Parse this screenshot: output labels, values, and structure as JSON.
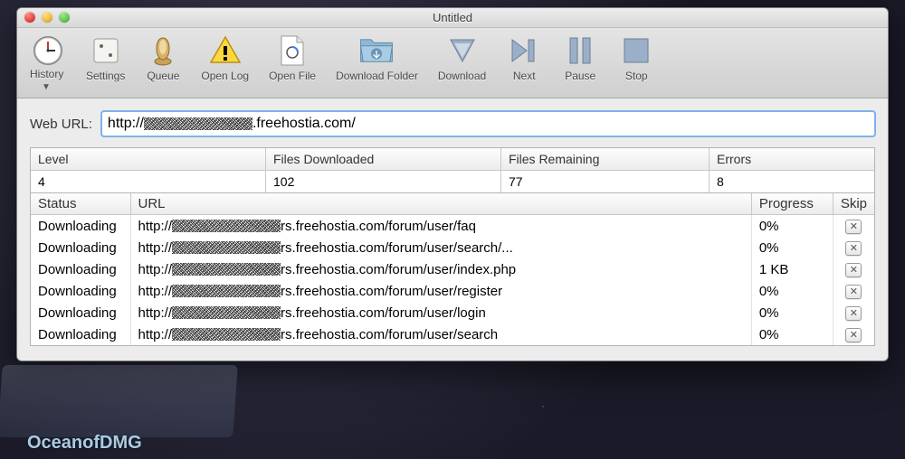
{
  "window": {
    "title": "Untitled"
  },
  "toolbar": {
    "history": "History",
    "settings": "Settings",
    "queue": "Queue",
    "openlog": "Open Log",
    "openfile": "Open File",
    "dlfolder": "Download Folder",
    "download": "Download",
    "next": "Next",
    "pause": "Pause",
    "stop": "Stop"
  },
  "url": {
    "label": "Web URL:",
    "prefix": "http://",
    "suffix": ".freehostia.com/"
  },
  "stats": {
    "headers": {
      "level": "Level",
      "filesdl": "Files Downloaded",
      "filesrem": "Files Remaining",
      "errors": "Errors"
    },
    "values": {
      "level": "4",
      "filesdl": "102",
      "filesrem": "77",
      "errors": "8"
    }
  },
  "table": {
    "headers": {
      "status": "Status",
      "url": "URL",
      "progress": "Progress",
      "skip": "Skip"
    },
    "rows": [
      {
        "status": "Downloading",
        "url_suffix": "rs.freehostia.com/forum/user/faq",
        "progress": "0%"
      },
      {
        "status": "Downloading",
        "url_suffix": "rs.freehostia.com/forum/user/search/...",
        "progress": "0%"
      },
      {
        "status": "Downloading",
        "url_suffix": "rs.freehostia.com/forum/user/index.php",
        "progress": "1 KB"
      },
      {
        "status": "Downloading",
        "url_suffix": "rs.freehostia.com/forum/user/register",
        "progress": "0%"
      },
      {
        "status": "Downloading",
        "url_suffix": "rs.freehostia.com/forum/user/login",
        "progress": "0%"
      },
      {
        "status": "Downloading",
        "url_suffix": "rs.freehostia.com/forum/user/search",
        "progress": "0%"
      }
    ]
  },
  "watermark": "OceanofDMG"
}
